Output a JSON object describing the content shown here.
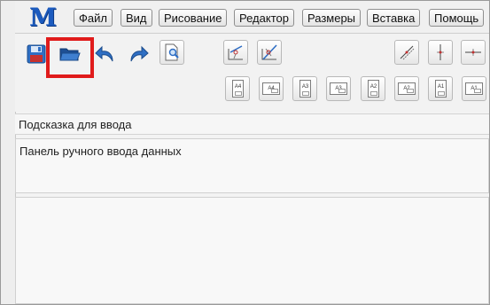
{
  "app": {
    "logo_text": "M"
  },
  "menu": {
    "items": [
      {
        "label": "Файл"
      },
      {
        "label": "Вид"
      },
      {
        "label": "Рисование"
      },
      {
        "label": "Редактор"
      },
      {
        "label": "Размеры"
      },
      {
        "label": "Вставка"
      },
      {
        "label": "Помощь"
      }
    ]
  },
  "toolbar": {
    "row1_icons": [
      "save-icon",
      "open-folder-icon",
      "undo-icon",
      "redo-icon",
      "print-preview-icon",
      "snap-point-icon",
      "snap-cross-icon",
      "dimension-aligned-icon",
      "dimension-vertical-icon",
      "dimension-horizontal-icon"
    ],
    "highlighted": "open-folder-icon",
    "highlight_color": "#e01b1b",
    "formats": [
      {
        "label": "A4",
        "orientation": "portrait"
      },
      {
        "label": "A4",
        "orientation": "landscape"
      },
      {
        "label": "A3",
        "orientation": "portrait"
      },
      {
        "label": "A3",
        "orientation": "landscape"
      },
      {
        "label": "A2",
        "orientation": "portrait"
      },
      {
        "label": "A2",
        "orientation": "landscape"
      },
      {
        "label": "A1",
        "orientation": "portrait"
      },
      {
        "label": "A1",
        "orientation": "landscape"
      }
    ]
  },
  "hint_panel": {
    "label": "Подсказка для ввода"
  },
  "input_panel": {
    "label": "Панель ручного ввода данных"
  },
  "colors": {
    "logo": "#1c5bbf",
    "accent_blue": "#2b6cc4",
    "highlight": "#e01b1b"
  }
}
